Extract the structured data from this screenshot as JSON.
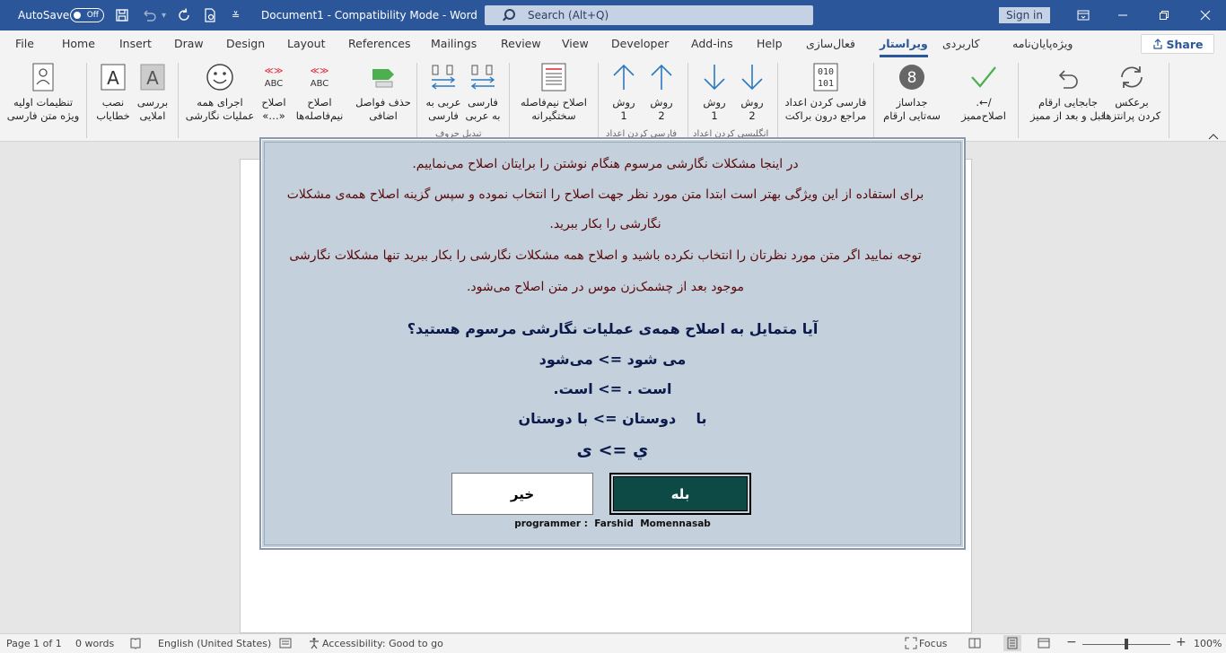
{
  "titlebar": {
    "autosave_label": "AutoSave",
    "autosave_state": "Off",
    "document_title": "Document1  -  Compatibility Mode  -  Word",
    "search_placeholder": "Search (Alt+Q)",
    "sign_in": "Sign in",
    "accent_color": "#2b579a"
  },
  "tabs": [
    {
      "label": "File"
    },
    {
      "label": "Home"
    },
    {
      "label": "Insert"
    },
    {
      "label": "Draw"
    },
    {
      "label": "Design"
    },
    {
      "label": "Layout"
    },
    {
      "label": "References"
    },
    {
      "label": "Mailings"
    },
    {
      "label": "Review"
    },
    {
      "label": "View"
    },
    {
      "label": "Developer"
    },
    {
      "label": "Add-ins"
    },
    {
      "label": "Help"
    },
    {
      "label": "فعال‌سازی"
    },
    {
      "label": "ویراستار",
      "active": true
    },
    {
      "label": "کاربردی"
    },
    {
      "label": "ویژه‌پایان‌نامه"
    }
  ],
  "share_label": "Share",
  "ribbon": {
    "buttons": [
      {
        "label": "تنظیمات اولیه\nویژه متن فارسی",
        "icon": "person-settings-icon"
      },
      {
        "label": "نصب\nخطایاب",
        "icon": "text-a-icon"
      },
      {
        "label": "بررسی\nاملایی",
        "icon": "text-a-shaded-icon"
      },
      {
        "label": "اجرای همه\nعملیات نگارشی",
        "icon": "smiley-icon"
      },
      {
        "label": "اصلاح\n«…»",
        "icon": "abc-arrows-icon"
      },
      {
        "label": "اصلاح\nنیم‌فاصله‌ها",
        "icon": "abc-space-icon"
      },
      {
        "label": "حذف فواصل\nاضافی",
        "icon": "space-remove-icon"
      },
      {
        "label": "عربی به\nفارسی",
        "icon": "convert-arrows-icon"
      },
      {
        "label": "فارسی\nبه عربی",
        "icon": "convert-arrows-icon"
      },
      {
        "label": "اصلاح نیم‌فاصله\nسختگیرانه",
        "icon": "document-lines-icon"
      },
      {
        "label": "روش\n1",
        "icon": "arrow-up-icon"
      },
      {
        "label": "روش\n2",
        "icon": "arrow-up-icon"
      },
      {
        "label": "روش\n1",
        "icon": "arrow-down-icon"
      },
      {
        "label": "روش\n2",
        "icon": "arrow-down-icon"
      },
      {
        "label": "فارسی کردن اعداد\nمراجع درون براکت",
        "icon": "binary-icon"
      },
      {
        "label": "جداساز\nسه‌تایی ارقام",
        "icon": "digit-8-icon"
      },
      {
        "label": "/←.\nاصلاح‌ممیز",
        "icon": "checkmark-icon"
      },
      {
        "label": "جابجایی ارقام\nقبل و بعد از ممیز",
        "icon": "undo-arrow-icon"
      },
      {
        "label": "برعکس\nکردن پرانتزها",
        "icon": "refresh-icon"
      }
    ],
    "groups": [
      "تبدیل حروف",
      "فارسی کردن اعداد",
      "انگلیسی کردن اعداد"
    ]
  },
  "dialog": {
    "intro_lines": [
      "در اینجا مشکلات نگارشی مرسوم هنگام نوشتن را برایتان اصلاح می‌نماییم.",
      "برای استفاده از این ویژگی بهتر است ابتدا متن مورد نظر جهت اصلاح را انتخاب نموده و سپس گزینه اصلاح همه‌ی مشکلات",
      "نگارشی را بکار ببرید.",
      "توجه نمایید اگر متن مورد نظرتان را انتخاب نکرده باشید و اصلاح همه مشکلات نگارشی را بکار ببرید تنها مشکلات نگارشی",
      "موجود بعد از چشمک‌زن موس در متن اصلاح می‌شود."
    ],
    "question": "آیا متمایل به اصلاح همه‌ی عملیات نگارشی مرسوم هستید؟",
    "examples": [
      "می شود => می‌شود",
      "است . => است.",
      "با    دوستان => با دوستان",
      "ي => ی"
    ],
    "yes_label": "بله",
    "no_label": "خیر",
    "credit": "programmer :  Farshid  Momennasab"
  },
  "statusbar": {
    "page": "Page 1 of 1",
    "words": "0 words",
    "language": "English (United States)",
    "accessibility": "Accessibility: Good to go",
    "focus": "Focus",
    "zoom": "100%"
  }
}
